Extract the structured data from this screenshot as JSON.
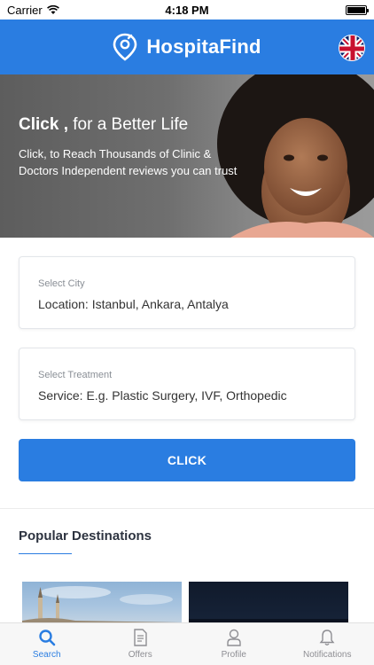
{
  "status": {
    "carrier": "Carrier",
    "time": "4:18 PM"
  },
  "header": {
    "app_name": "HospitaFind",
    "language_flag_icon": "uk-flag-icon"
  },
  "hero": {
    "title_bold": "Click ,",
    "title_rest": " for a Better Life",
    "subtitle": "Click, to Reach Thousands of Clinic & Doctors Independent reviews you can trust"
  },
  "city_field": {
    "label": "Select City",
    "value": "Location: Istanbul, Ankara, Antalya"
  },
  "treatment_field": {
    "label": "Select Treatment",
    "value": "Service: E.g. Plastic Surgery, IVF, Orthopedic"
  },
  "cta": {
    "label": "CLICK"
  },
  "popular": {
    "title": "Popular Destinations"
  },
  "tabs": [
    {
      "label": "Search",
      "icon": "search-icon",
      "active": true
    },
    {
      "label": "Offers",
      "icon": "document-icon",
      "active": false
    },
    {
      "label": "Profile",
      "icon": "user-icon",
      "active": false
    },
    {
      "label": "Notifications",
      "icon": "bell-icon",
      "active": false
    }
  ],
  "colors": {
    "brand_blue": "#2a7de1",
    "background": "#ffffff",
    "muted_text": "#8a8f96"
  }
}
